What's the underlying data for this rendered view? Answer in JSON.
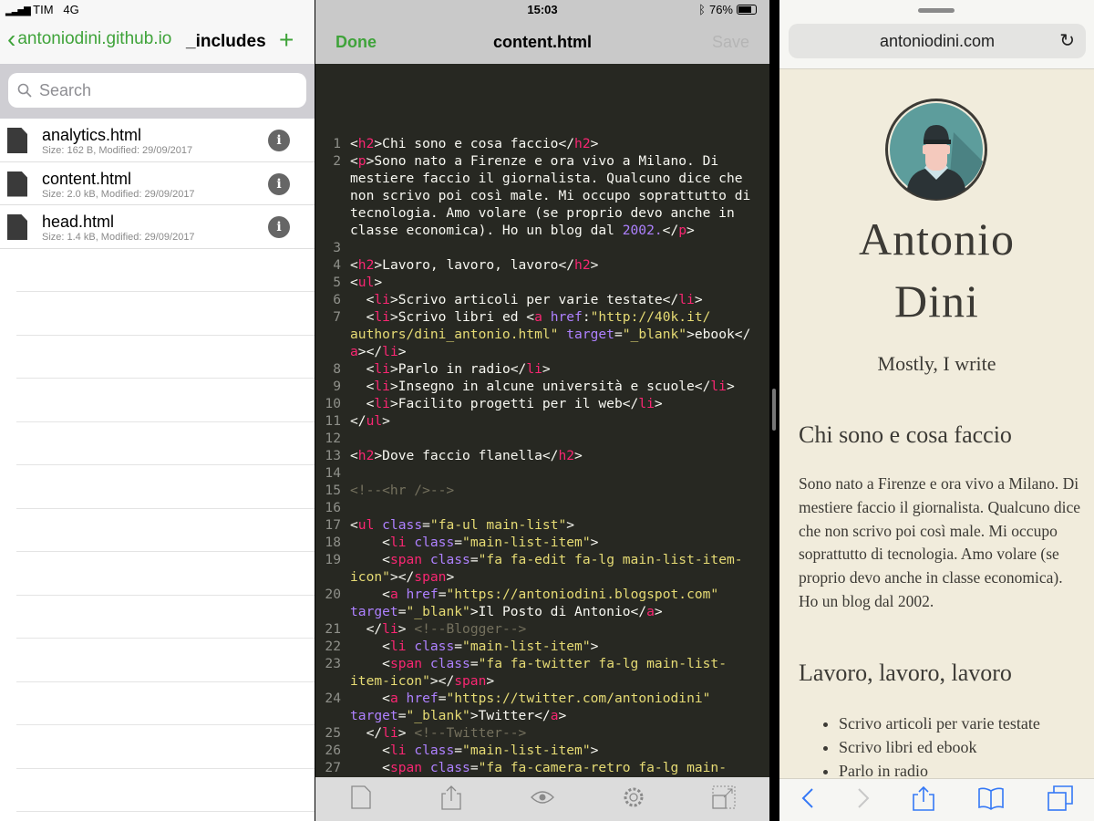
{
  "status": {
    "carrier": "TIM",
    "network": "4G",
    "time": "15:03",
    "battery": "76%"
  },
  "files_pane": {
    "back_label": "antoniodini.github.io",
    "title": "_includes",
    "add_label": "+",
    "search_placeholder": "Search",
    "files": [
      {
        "name": "analytics.html",
        "meta": "Size: 162 B, Modified: 29/09/2017"
      },
      {
        "name": "content.html",
        "meta": "Size: 2.0 kB, Modified: 29/09/2017"
      },
      {
        "name": "head.html",
        "meta": "Size: 1.4 kB, Modified: 29/09/2017"
      }
    ]
  },
  "editor": {
    "done_label": "Done",
    "title": "content.html",
    "save_label": "Save",
    "toolbar_icons": [
      "new-file-icon",
      "share-icon",
      "preview-eye-icon",
      "settings-gear-icon",
      "resize-icon"
    ],
    "rows": [
      [
        "1",
        [
          [
            "x",
            "<"
          ],
          [
            "t",
            "h2"
          ],
          [
            "x",
            ">Chi sono e cosa faccio</"
          ],
          [
            "t",
            "h2"
          ],
          [
            "x",
            ">"
          ]
        ]
      ],
      [
        "2",
        [
          [
            "x",
            "<"
          ],
          [
            "t",
            "p"
          ],
          [
            "x",
            ">Sono nato a Firenze e ora vivo a Milano. Di"
          ]
        ]
      ],
      [
        "",
        [
          [
            "x",
            "mestiere faccio il giornalista. Qualcuno dice che"
          ]
        ]
      ],
      [
        "",
        [
          [
            "x",
            "non scrivo poi così male. Mi occupo soprattutto di"
          ]
        ]
      ],
      [
        "",
        [
          [
            "x",
            "tecnologia. Amo volare (se proprio devo anche in"
          ]
        ]
      ],
      [
        "",
        [
          [
            "x",
            "classe economica). Ho un blog dal "
          ],
          [
            "a",
            "2002."
          ],
          [
            "x",
            "</"
          ],
          [
            "t",
            "p"
          ],
          [
            "x",
            ">"
          ]
        ]
      ],
      [
        "3",
        []
      ],
      [
        "4",
        [
          [
            "x",
            "<"
          ],
          [
            "t",
            "h2"
          ],
          [
            "x",
            ">Lavoro, lavoro, lavoro</"
          ],
          [
            "t",
            "h2"
          ],
          [
            "x",
            ">"
          ]
        ]
      ],
      [
        "5",
        [
          [
            "x",
            "<"
          ],
          [
            "t",
            "ul"
          ],
          [
            "x",
            ">"
          ]
        ]
      ],
      [
        "6",
        [
          [
            "x",
            "  <"
          ],
          [
            "t",
            "li"
          ],
          [
            "x",
            ">Scrivo articoli per varie testate</"
          ],
          [
            "t",
            "li"
          ],
          [
            "x",
            ">"
          ]
        ]
      ],
      [
        "7",
        [
          [
            "x",
            "  <"
          ],
          [
            "t",
            "li"
          ],
          [
            "x",
            ">Scrivo libri ed <"
          ],
          [
            "t",
            "a"
          ],
          [
            "x",
            " "
          ],
          [
            "a",
            "href"
          ],
          [
            "x",
            ":"
          ],
          [
            "s",
            "\"http://40k.it/"
          ]
        ]
      ],
      [
        "",
        [
          [
            "s",
            "authors/dini_antonio.html\""
          ],
          [
            "x",
            " "
          ],
          [
            "a",
            "target"
          ],
          [
            "x",
            "="
          ],
          [
            "s",
            "\"_blank\""
          ],
          [
            "x",
            ">ebook</"
          ]
        ]
      ],
      [
        "",
        [
          [
            "t",
            "a"
          ],
          [
            "x",
            "></"
          ],
          [
            "t",
            "li"
          ],
          [
            "x",
            ">"
          ]
        ]
      ],
      [
        "8",
        [
          [
            "x",
            "  <"
          ],
          [
            "t",
            "li"
          ],
          [
            "x",
            ">Parlo in radio</"
          ],
          [
            "t",
            "li"
          ],
          [
            "x",
            ">"
          ]
        ]
      ],
      [
        "9",
        [
          [
            "x",
            "  <"
          ],
          [
            "t",
            "li"
          ],
          [
            "x",
            ">Insegno in alcune università e scuole</"
          ],
          [
            "t",
            "li"
          ],
          [
            "x",
            ">"
          ]
        ]
      ],
      [
        "10",
        [
          [
            "x",
            "  <"
          ],
          [
            "t",
            "li"
          ],
          [
            "x",
            ">Facilito progetti per il web</"
          ],
          [
            "t",
            "li"
          ],
          [
            "x",
            ">"
          ]
        ]
      ],
      [
        "11",
        [
          [
            "x",
            "</"
          ],
          [
            "t",
            "ul"
          ],
          [
            "x",
            ">"
          ]
        ]
      ],
      [
        "12",
        []
      ],
      [
        "13",
        [
          [
            "x",
            "<"
          ],
          [
            "t",
            "h2"
          ],
          [
            "x",
            ">Dove faccio flanella</"
          ],
          [
            "t",
            "h2"
          ],
          [
            "x",
            ">"
          ]
        ]
      ],
      [
        "14",
        []
      ],
      [
        "15",
        [
          [
            "c",
            "<!--<hr />-->"
          ]
        ]
      ],
      [
        "16",
        []
      ],
      [
        "17",
        [
          [
            "x",
            "<"
          ],
          [
            "t",
            "ul"
          ],
          [
            "x",
            " "
          ],
          [
            "a",
            "class"
          ],
          [
            "x",
            "="
          ],
          [
            "s",
            "\"fa-ul main-list\""
          ],
          [
            "x",
            ">"
          ]
        ]
      ],
      [
        "18",
        [
          [
            "x",
            "    <"
          ],
          [
            "t",
            "li"
          ],
          [
            "x",
            " "
          ],
          [
            "a",
            "class"
          ],
          [
            "x",
            "="
          ],
          [
            "s",
            "\"main-list-item\""
          ],
          [
            "x",
            ">"
          ]
        ]
      ],
      [
        "19",
        [
          [
            "x",
            "    <"
          ],
          [
            "t",
            "span"
          ],
          [
            "x",
            " "
          ],
          [
            "a",
            "class"
          ],
          [
            "x",
            "="
          ],
          [
            "s",
            "\"fa fa-edit fa-lg main-list-item-"
          ]
        ]
      ],
      [
        "",
        [
          [
            "s",
            "icon\""
          ],
          [
            "x",
            "></"
          ],
          [
            "t",
            "span"
          ],
          [
            "x",
            ">"
          ]
        ]
      ],
      [
        "20",
        [
          [
            "x",
            "    <"
          ],
          [
            "t",
            "a"
          ],
          [
            "x",
            " "
          ],
          [
            "a",
            "href"
          ],
          [
            "x",
            "="
          ],
          [
            "s",
            "\"https://antoniodini.blogspot.com\""
          ]
        ]
      ],
      [
        "",
        [
          [
            "a",
            "target"
          ],
          [
            "x",
            "="
          ],
          [
            "s",
            "\"_blank\""
          ],
          [
            "x",
            ">Il Posto di Antonio</"
          ],
          [
            "t",
            "a"
          ],
          [
            "x",
            ">"
          ]
        ]
      ],
      [
        "21",
        [
          [
            "x",
            "  </"
          ],
          [
            "t",
            "li"
          ],
          [
            "x",
            "> "
          ],
          [
            "c",
            "<!--Blogger-->"
          ]
        ]
      ],
      [
        "22",
        [
          [
            "x",
            "    <"
          ],
          [
            "t",
            "li"
          ],
          [
            "x",
            " "
          ],
          [
            "a",
            "class"
          ],
          [
            "x",
            "="
          ],
          [
            "s",
            "\"main-list-item\""
          ],
          [
            "x",
            ">"
          ]
        ]
      ],
      [
        "23",
        [
          [
            "x",
            "    <"
          ],
          [
            "t",
            "span"
          ],
          [
            "x",
            " "
          ],
          [
            "a",
            "class"
          ],
          [
            "x",
            "="
          ],
          [
            "s",
            "\"fa fa-twitter fa-lg main-list-"
          ]
        ]
      ],
      [
        "",
        [
          [
            "s",
            "item-icon\""
          ],
          [
            "x",
            "></"
          ],
          [
            "t",
            "span"
          ],
          [
            "x",
            ">"
          ]
        ]
      ],
      [
        "24",
        [
          [
            "x",
            "    <"
          ],
          [
            "t",
            "a"
          ],
          [
            "x",
            " "
          ],
          [
            "a",
            "href"
          ],
          [
            "x",
            "="
          ],
          [
            "s",
            "\"https://twitter.com/antoniodini\""
          ]
        ]
      ],
      [
        "",
        [
          [
            "a",
            "target"
          ],
          [
            "x",
            "="
          ],
          [
            "s",
            "\"_blank\""
          ],
          [
            "x",
            ">Twitter</"
          ],
          [
            "t",
            "a"
          ],
          [
            "x",
            ">"
          ]
        ]
      ],
      [
        "25",
        [
          [
            "x",
            "  </"
          ],
          [
            "t",
            "li"
          ],
          [
            "x",
            "> "
          ],
          [
            "c",
            "<!--Twitter-->"
          ]
        ]
      ],
      [
        "26",
        [
          [
            "x",
            "    <"
          ],
          [
            "t",
            "li"
          ],
          [
            "x",
            " "
          ],
          [
            "a",
            "class"
          ],
          [
            "x",
            "="
          ],
          [
            "s",
            "\"main-list-item\""
          ],
          [
            "x",
            ">"
          ]
        ]
      ],
      [
        "27",
        [
          [
            "x",
            "    <"
          ],
          [
            "t",
            "span"
          ],
          [
            "x",
            " "
          ],
          [
            "a",
            "class"
          ],
          [
            "x",
            "="
          ],
          [
            "s",
            "\"fa fa-camera-retro fa-lg main-"
          ]
        ]
      ]
    ]
  },
  "browser": {
    "url": "antoniodini.com",
    "name_line1": "Antonio",
    "name_line2": "Dini",
    "tagline": "Mostly, I write",
    "h2_1": "Chi sono e cosa faccio",
    "paragraph": "Sono nato a Firenze e ora vivo a Milano. Di mestiere faccio il giornalista. Qualcuno dice che non scrivo poi così male. Mi occupo soprattutto di tecnologia. Amo volare (se proprio devo anche in classe economica). Ho un blog dal 2002.",
    "h2_2": "Lavoro, lavoro, lavoro",
    "list": [
      "Scrivo articoli per varie testate",
      "Scrivo libri ed ebook",
      "Parlo in radio"
    ]
  },
  "colors": {
    "accent_green": "#3fa33a",
    "editor_bg": "#272822",
    "page_bg": "#f1ecdc",
    "safari_blue": "#3478f6"
  }
}
